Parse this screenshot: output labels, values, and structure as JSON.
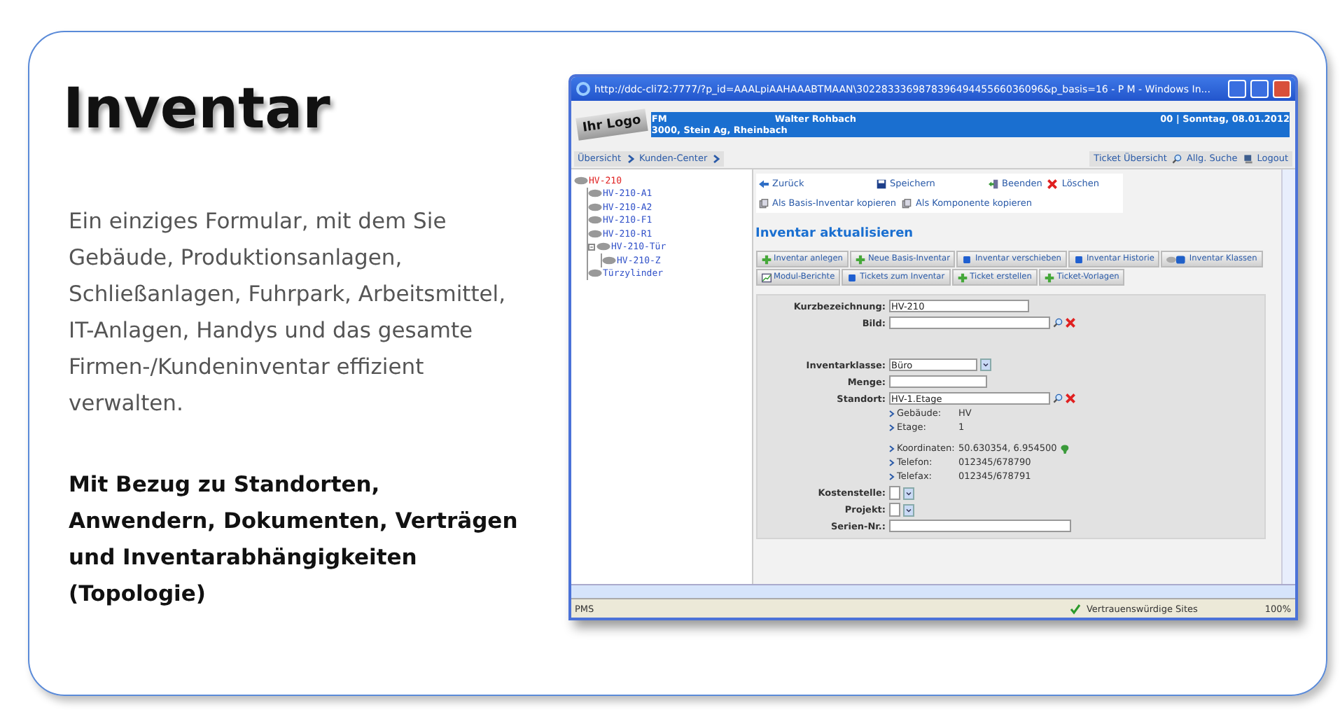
{
  "slide": {
    "title": "Inventar",
    "description": "Ein einziges Formular, mit dem Sie Gebäude, Produktionsanlagen, Schließanlagen, Fuhrpark, Arbeitsmittel, IT-Anlagen, Handys und das gesamte Firmen-/Kundeninventar effizient verwalten.",
    "highlight": "Mit Bezug zu Standorten, Anwendern, Dokumenten, Verträgen und Inventarabhängigkeiten (Topologie)"
  },
  "browser": {
    "title": "http://ddc-cli72:7777/?p_id=AAALpiAAHAAABTMAAN\\302283336987839649445566036096&p_basis=16 - P M  - Windows In...",
    "header": {
      "logo": "Ihr Logo",
      "org": "FM",
      "address": "3000, Stein Ag, Rheinbach",
      "user": "Walter Rohbach",
      "date": "00 | Sonntag, 08.01.2012"
    },
    "breadcrumb": [
      "Übersicht",
      "Kunden-Center"
    ],
    "top_links": [
      {
        "label": "Ticket Übersicht",
        "kind": "plain"
      },
      {
        "label": "Allg. Suche",
        "kind": "search"
      },
      {
        "label": "Logout",
        "kind": "logout"
      }
    ],
    "tree": [
      {
        "label": "HV-210",
        "selected": true,
        "children": [
          {
            "label": "HV-210-A1",
            "selected": false
          },
          {
            "label": "HV-210-A2",
            "selected": false
          },
          {
            "label": "HV-210-F1",
            "selected": false
          },
          {
            "label": "HV-210-R1",
            "selected": false
          },
          {
            "label": "HV-210-Tür",
            "selected": false,
            "children": [
              {
                "label": "HV-210-Z",
                "selected": false
              }
            ]
          },
          {
            "label": "Türzylinder",
            "selected": false
          }
        ]
      }
    ],
    "actions": [
      {
        "label": "Zurück",
        "kind": "back"
      },
      {
        "label": "Speichern",
        "kind": "save"
      },
      {
        "label": "Beenden",
        "kind": "exit"
      },
      {
        "label": "Löschen",
        "kind": "delete"
      },
      {
        "label": "Als Basis-Inventar kopieren",
        "kind": "copy"
      },
      {
        "label": "Als Komponente kopieren",
        "kind": "copy"
      }
    ],
    "form_title": "Inventar aktualisieren",
    "tool_buttons": [
      {
        "label": "Inventar anlegen",
        "kind": "plus"
      },
      {
        "label": "Neue Basis-Inventar",
        "kind": "plus"
      },
      {
        "label": "Inventar verschieben",
        "kind": "square"
      },
      {
        "label": "Inventar Historie",
        "kind": "square"
      },
      {
        "label": "Inventar Klassen",
        "kind": "classes"
      },
      {
        "label": "Modul-Berichte",
        "kind": "chart"
      },
      {
        "label": "Tickets zum Inventar",
        "kind": "square"
      },
      {
        "label": "Ticket erstellen",
        "kind": "plus"
      },
      {
        "label": "Ticket-Vorlagen",
        "kind": "plus"
      }
    ],
    "form": [
      {
        "label": "Kurzbezeichnung:",
        "kind": "text",
        "value": "HV-210"
      },
      {
        "label": "Bild:",
        "kind": "picker"
      },
      {
        "label": "Inventarklasse:",
        "kind": "select",
        "value": "Büro"
      },
      {
        "label": "Menge:",
        "kind": "short"
      },
      {
        "label": "Standort:",
        "kind": "picker",
        "value": "HV-1.Etage",
        "detail_groups": [
          [
            {
              "label": "Gebäude:",
              "value": "HV",
              "map_icon": false
            },
            {
              "label": "Etage:",
              "value": "1",
              "map_icon": false
            }
          ],
          [
            {
              "label": "Koordinaten:",
              "value": "50.630354, 6.954500",
              "map_icon": true
            },
            {
              "label": "Telefon:",
              "value": "012345/678790",
              "map_icon": false
            },
            {
              "label": "Telefax:",
              "value": "012345/678791",
              "map_icon": false
            }
          ]
        ]
      },
      {
        "label": "Kostenstelle:",
        "kind": "mini-select"
      },
      {
        "label": "Projekt:",
        "kind": "mini-select"
      },
      {
        "label": "Serien-Nr.:",
        "kind": "text"
      }
    ],
    "status_bar": {
      "left": "PMS",
      "zone": "Vertrauenswürdige Sites",
      "zoom": "100%"
    }
  }
}
